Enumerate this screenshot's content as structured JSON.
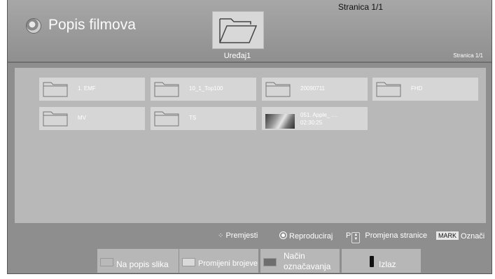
{
  "header": {
    "title": "Popis filmova",
    "device_label": "Uređaj1",
    "page_top": "Stranica 1/1",
    "page_right": "Stranica 1/1"
  },
  "items": [
    {
      "label": "1. EMF",
      "kind": "folder"
    },
    {
      "label": "10_1_Top100",
      "kind": "folder"
    },
    {
      "label": "20090711",
      "kind": "folder"
    },
    {
      "label": "FHD",
      "kind": "folder"
    },
    {
      "label": "MV",
      "kind": "folder"
    },
    {
      "label": "TS",
      "kind": "folder"
    },
    {
      "label": "051. Apple_ ....",
      "duration": "02:30:25",
      "kind": "video"
    }
  ],
  "hints": {
    "move": "Premjesti",
    "play": "Reproduciraj",
    "page_prefix": "P",
    "page_change": "Promjena stranice",
    "mark_key": "MARK",
    "mark": "Označi"
  },
  "buttons": {
    "to_pictures": "Na popis slika",
    "change_numbers": "Promijeni brojeve",
    "mark_mode_line1": "Način",
    "mark_mode_line2": "označavanja",
    "exit": "Izlaz"
  },
  "colors": {
    "background": "#8e8e8e",
    "panel": "#b8b8b8",
    "tile": "#d6d6d6",
    "red_key": "#b9b9b9",
    "green_key": "#d9d9d9",
    "yellow_key": "#6e6e6e"
  }
}
